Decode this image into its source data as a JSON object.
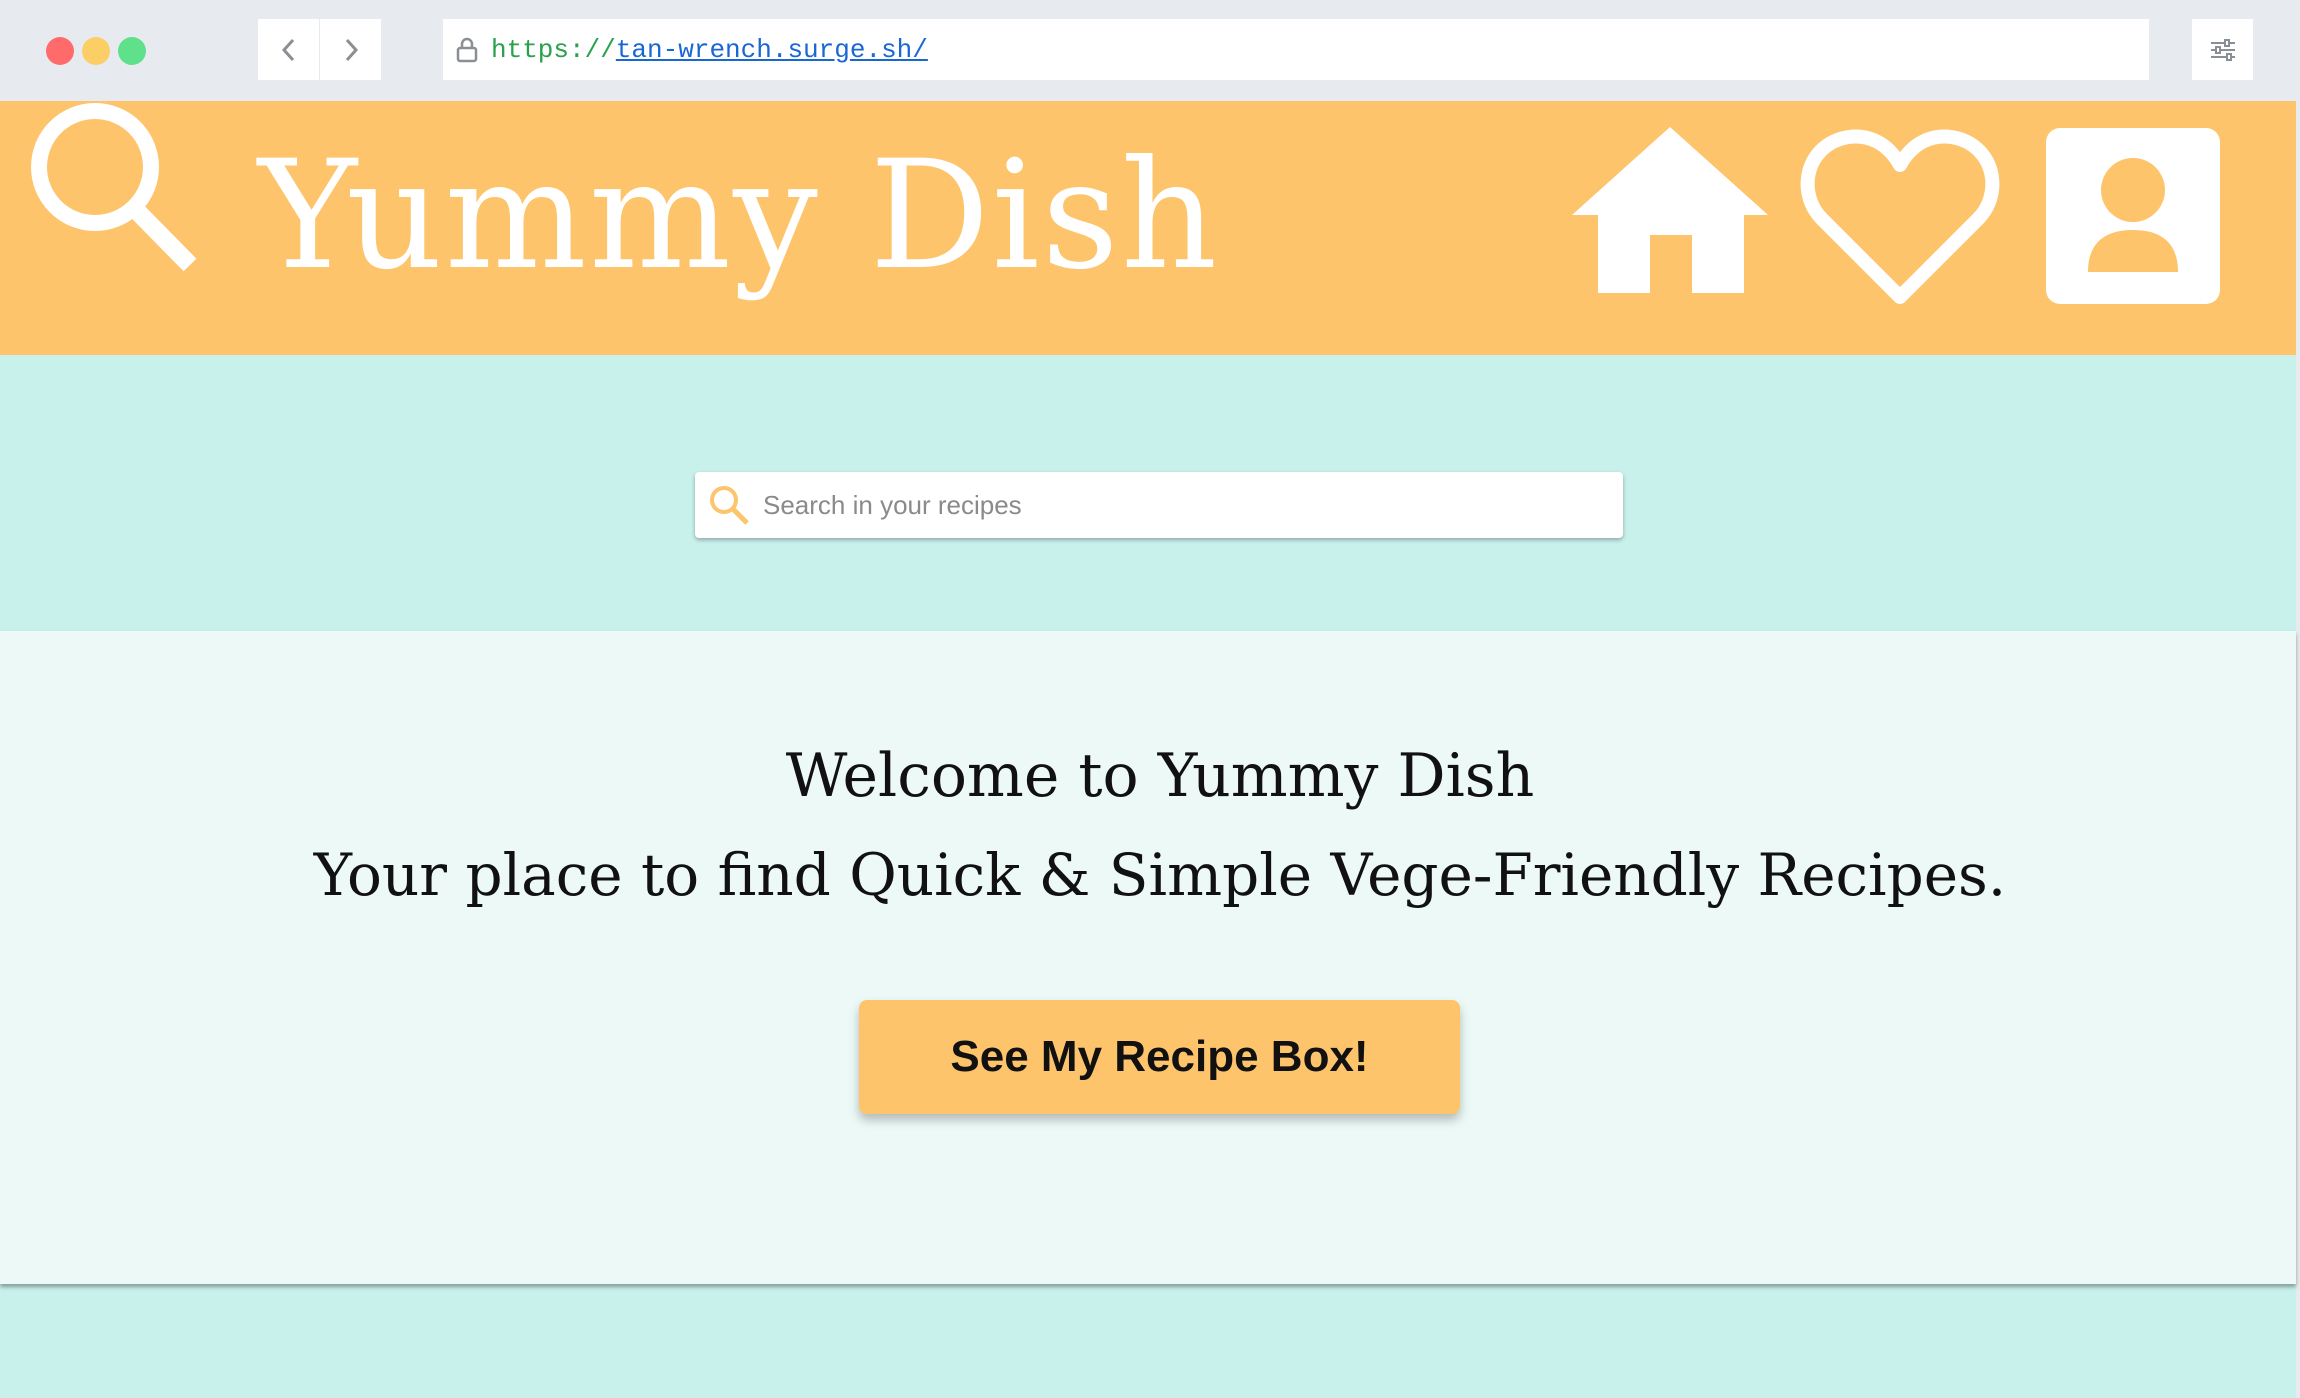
{
  "browser": {
    "url_scheme": "https://",
    "url_host": "tan-wrench.surge.sh/",
    "colors": {
      "close": "#ff6b6b",
      "minimize": "#fccf66",
      "maximize": "#5fe08b"
    }
  },
  "header": {
    "title": "Yummy Dish",
    "background": "#fdc46b",
    "icons": [
      "search-icon",
      "home-icon",
      "heart-icon",
      "user-icon"
    ]
  },
  "search": {
    "placeholder": "Search in your recipes",
    "icon": "search-icon"
  },
  "welcome": {
    "line1": "Welcome to Yummy Dish",
    "line2": "Your place to find Quick & Simple Vege-Friendly Recipes.",
    "cta_label": "See My Recipe Box!"
  },
  "colors": {
    "accent": "#fdc46b",
    "band": "#c9f1ec",
    "panel": "#ecf9f7"
  }
}
